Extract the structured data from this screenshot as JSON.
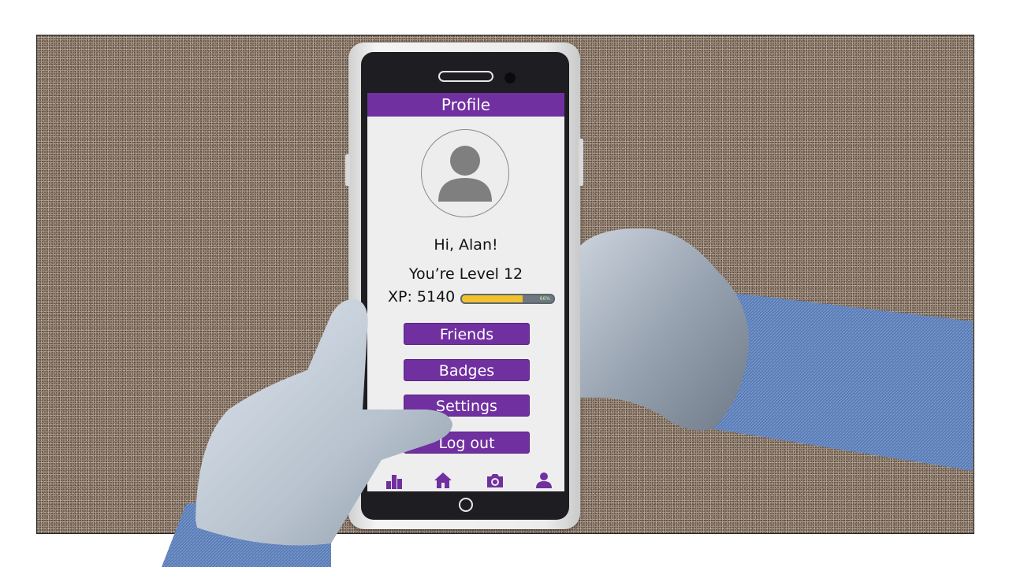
{
  "screen": {
    "title": "Profile",
    "greeting": "Hi, Alan!",
    "level_text": "You’re Level 12",
    "xp": {
      "label": "XP:",
      "value": "5140",
      "progress": 0.66,
      "progress_label": "66%"
    },
    "menu": [
      {
        "label": "Friends"
      },
      {
        "label": "Badges"
      },
      {
        "label": "Settings"
      },
      {
        "label": "Log out"
      }
    ],
    "nav": [
      {
        "icon": "leaderboard-icon"
      },
      {
        "icon": "home-icon"
      },
      {
        "icon": "camera-icon"
      },
      {
        "icon": "user-icon"
      }
    ]
  },
  "colors": {
    "accent": "#7030a0",
    "screen_bg": "#eeeeee",
    "xp_fill": "#f2c12e",
    "xp_track": "#6f7880",
    "background": "#9b8a7b",
    "sleeve": "#5c7fb8",
    "skin": "#b9c4cf"
  }
}
